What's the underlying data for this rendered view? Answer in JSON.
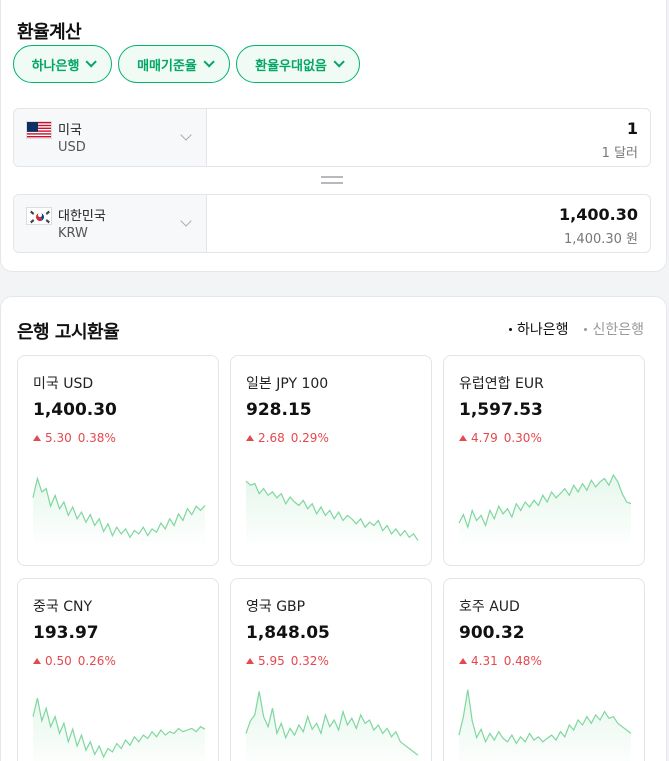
{
  "calculator": {
    "title": "환율계산",
    "chips": [
      {
        "label": "하나은행"
      },
      {
        "label": "매매기준율"
      },
      {
        "label": "환율우대없음"
      }
    ],
    "from": {
      "name": "미국",
      "code": "USD",
      "amount": "1",
      "amount_text": "1 달러"
    },
    "to": {
      "name": "대한민국",
      "code": "KRW",
      "amount": "1,400.30",
      "amount_text": "1,400.30 원"
    }
  },
  "rates": {
    "title": "은행 고시환율",
    "banks": [
      {
        "label": "하나은행",
        "active": true
      },
      {
        "label": "신한은행",
        "active": false
      }
    ],
    "cards": [
      {
        "name": "미국 USD",
        "value": "1,400.30",
        "change": "5.30",
        "percent": "0.38%",
        "spark": [
          0.55,
          0.78,
          0.62,
          0.66,
          0.45,
          0.58,
          0.42,
          0.5,
          0.34,
          0.44,
          0.3,
          0.38,
          0.26,
          0.35,
          0.22,
          0.3,
          0.15,
          0.24,
          0.1,
          0.2,
          0.12,
          0.18,
          0.08,
          0.16,
          0.12,
          0.2,
          0.1,
          0.18,
          0.14,
          0.25,
          0.18,
          0.3,
          0.22,
          0.36,
          0.28,
          0.42,
          0.35,
          0.45,
          0.4,
          0.46
        ]
      },
      {
        "name": "일본 JPY 100",
        "value": "928.15",
        "change": "2.68",
        "percent": "0.29%",
        "spark": [
          0.75,
          0.7,
          0.72,
          0.6,
          0.66,
          0.58,
          0.62,
          0.55,
          0.6,
          0.48,
          0.56,
          0.5,
          0.46,
          0.52,
          0.42,
          0.48,
          0.36,
          0.44,
          0.34,
          0.4,
          0.3,
          0.38,
          0.28,
          0.34,
          0.3,
          0.24,
          0.3,
          0.2,
          0.26,
          0.22,
          0.28,
          0.16,
          0.22,
          0.12,
          0.18,
          0.1,
          0.16,
          0.08,
          0.12,
          0.04
        ]
      },
      {
        "name": "유럽연합 EUR",
        "value": "1,597.53",
        "change": "4.79",
        "percent": "0.30%",
        "spark": [
          0.25,
          0.35,
          0.2,
          0.4,
          0.28,
          0.34,
          0.22,
          0.4,
          0.3,
          0.45,
          0.36,
          0.42,
          0.32,
          0.48,
          0.4,
          0.5,
          0.44,
          0.52,
          0.46,
          0.58,
          0.5,
          0.62,
          0.55,
          0.6,
          0.66,
          0.58,
          0.7,
          0.62,
          0.72,
          0.64,
          0.76,
          0.68,
          0.74,
          0.78,
          0.7,
          0.82,
          0.74,
          0.6,
          0.5,
          0.48
        ]
      },
      {
        "name": "중국 CNY",
        "value": "193.97",
        "change": "0.50",
        "percent": "0.26%",
        "spark": [
          0.6,
          0.82,
          0.55,
          0.7,
          0.48,
          0.6,
          0.4,
          0.52,
          0.3,
          0.45,
          0.25,
          0.38,
          0.2,
          0.3,
          0.15,
          0.25,
          0.12,
          0.22,
          0.18,
          0.28,
          0.22,
          0.32,
          0.26,
          0.36,
          0.3,
          0.38,
          0.34,
          0.42,
          0.36,
          0.44,
          0.38,
          0.42,
          0.4,
          0.46,
          0.42,
          0.44,
          0.46,
          0.42,
          0.48,
          0.45
        ]
      },
      {
        "name": "영국 GBP",
        "value": "1,848.05",
        "change": "5.95",
        "percent": "0.32%",
        "spark": [
          0.4,
          0.55,
          0.62,
          0.9,
          0.6,
          0.48,
          0.7,
          0.4,
          0.52,
          0.35,
          0.46,
          0.38,
          0.5,
          0.42,
          0.6,
          0.45,
          0.52,
          0.4,
          0.62,
          0.48,
          0.56,
          0.44,
          0.66,
          0.5,
          0.58,
          0.46,
          0.62,
          0.52,
          0.56,
          0.44,
          0.5,
          0.4,
          0.46,
          0.36,
          0.42,
          0.3,
          0.26,
          0.22,
          0.18,
          0.14
        ]
      },
      {
        "name": "호주 AUD",
        "value": "900.32",
        "change": "4.31",
        "percent": "0.48%",
        "spark": [
          0.38,
          0.6,
          0.92,
          0.55,
          0.35,
          0.45,
          0.3,
          0.4,
          0.32,
          0.42,
          0.34,
          0.3,
          0.38,
          0.28,
          0.36,
          0.3,
          0.4,
          0.32,
          0.36,
          0.3,
          0.34,
          0.38,
          0.32,
          0.42,
          0.36,
          0.5,
          0.44,
          0.56,
          0.5,
          0.6,
          0.52,
          0.62,
          0.56,
          0.66,
          0.58,
          0.6,
          0.52,
          0.48,
          0.44,
          0.4
        ]
      }
    ]
  },
  "colors": {
    "accent": "#03b26c",
    "up": "#e5484d",
    "spark_line": "#7ed79e",
    "spark_fill": "#e6f7ec"
  }
}
